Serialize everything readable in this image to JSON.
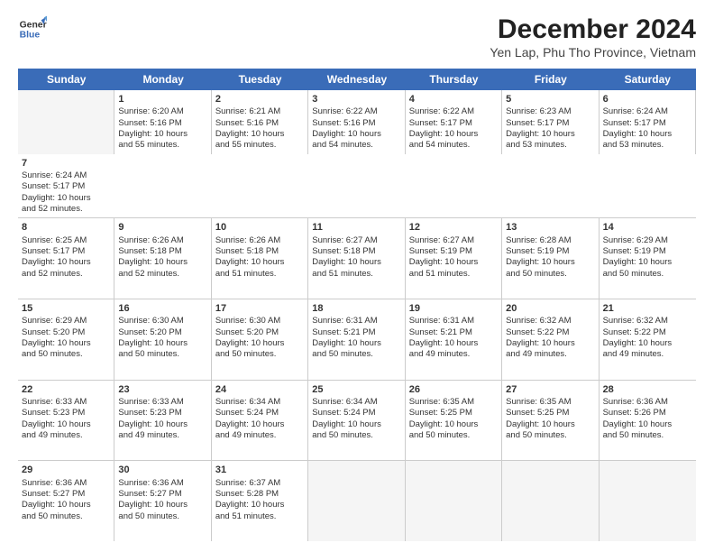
{
  "header": {
    "logo_line1": "General",
    "logo_line2": "Blue",
    "title": "December 2024",
    "subtitle": "Yen Lap, Phu Tho Province, Vietnam"
  },
  "days": [
    "Sunday",
    "Monday",
    "Tuesday",
    "Wednesday",
    "Thursday",
    "Friday",
    "Saturday"
  ],
  "rows": [
    [
      {
        "num": "",
        "lines": [],
        "empty": true
      },
      {
        "num": "1",
        "lines": [
          "Sunrise: 6:20 AM",
          "Sunset: 5:16 PM",
          "Daylight: 10 hours",
          "and 55 minutes."
        ],
        "empty": false
      },
      {
        "num": "2",
        "lines": [
          "Sunrise: 6:21 AM",
          "Sunset: 5:16 PM",
          "Daylight: 10 hours",
          "and 55 minutes."
        ],
        "empty": false
      },
      {
        "num": "3",
        "lines": [
          "Sunrise: 6:22 AM",
          "Sunset: 5:16 PM",
          "Daylight: 10 hours",
          "and 54 minutes."
        ],
        "empty": false
      },
      {
        "num": "4",
        "lines": [
          "Sunrise: 6:22 AM",
          "Sunset: 5:17 PM",
          "Daylight: 10 hours",
          "and 54 minutes."
        ],
        "empty": false
      },
      {
        "num": "5",
        "lines": [
          "Sunrise: 6:23 AM",
          "Sunset: 5:17 PM",
          "Daylight: 10 hours",
          "and 53 minutes."
        ],
        "empty": false
      },
      {
        "num": "6",
        "lines": [
          "Sunrise: 6:24 AM",
          "Sunset: 5:17 PM",
          "Daylight: 10 hours",
          "and 53 minutes."
        ],
        "empty": false
      },
      {
        "num": "7",
        "lines": [
          "Sunrise: 6:24 AM",
          "Sunset: 5:17 PM",
          "Daylight: 10 hours",
          "and 52 minutes."
        ],
        "empty": false
      }
    ],
    [
      {
        "num": "8",
        "lines": [
          "Sunrise: 6:25 AM",
          "Sunset: 5:17 PM",
          "Daylight: 10 hours",
          "and 52 minutes."
        ],
        "empty": false
      },
      {
        "num": "9",
        "lines": [
          "Sunrise: 6:26 AM",
          "Sunset: 5:18 PM",
          "Daylight: 10 hours",
          "and 52 minutes."
        ],
        "empty": false
      },
      {
        "num": "10",
        "lines": [
          "Sunrise: 6:26 AM",
          "Sunset: 5:18 PM",
          "Daylight: 10 hours",
          "and 51 minutes."
        ],
        "empty": false
      },
      {
        "num": "11",
        "lines": [
          "Sunrise: 6:27 AM",
          "Sunset: 5:18 PM",
          "Daylight: 10 hours",
          "and 51 minutes."
        ],
        "empty": false
      },
      {
        "num": "12",
        "lines": [
          "Sunrise: 6:27 AM",
          "Sunset: 5:19 PM",
          "Daylight: 10 hours",
          "and 51 minutes."
        ],
        "empty": false
      },
      {
        "num": "13",
        "lines": [
          "Sunrise: 6:28 AM",
          "Sunset: 5:19 PM",
          "Daylight: 10 hours",
          "and 50 minutes."
        ],
        "empty": false
      },
      {
        "num": "14",
        "lines": [
          "Sunrise: 6:29 AM",
          "Sunset: 5:19 PM",
          "Daylight: 10 hours",
          "and 50 minutes."
        ],
        "empty": false
      }
    ],
    [
      {
        "num": "15",
        "lines": [
          "Sunrise: 6:29 AM",
          "Sunset: 5:20 PM",
          "Daylight: 10 hours",
          "and 50 minutes."
        ],
        "empty": false
      },
      {
        "num": "16",
        "lines": [
          "Sunrise: 6:30 AM",
          "Sunset: 5:20 PM",
          "Daylight: 10 hours",
          "and 50 minutes."
        ],
        "empty": false
      },
      {
        "num": "17",
        "lines": [
          "Sunrise: 6:30 AM",
          "Sunset: 5:20 PM",
          "Daylight: 10 hours",
          "and 50 minutes."
        ],
        "empty": false
      },
      {
        "num": "18",
        "lines": [
          "Sunrise: 6:31 AM",
          "Sunset: 5:21 PM",
          "Daylight: 10 hours",
          "and 50 minutes."
        ],
        "empty": false
      },
      {
        "num": "19",
        "lines": [
          "Sunrise: 6:31 AM",
          "Sunset: 5:21 PM",
          "Daylight: 10 hours",
          "and 49 minutes."
        ],
        "empty": false
      },
      {
        "num": "20",
        "lines": [
          "Sunrise: 6:32 AM",
          "Sunset: 5:22 PM",
          "Daylight: 10 hours",
          "and 49 minutes."
        ],
        "empty": false
      },
      {
        "num": "21",
        "lines": [
          "Sunrise: 6:32 AM",
          "Sunset: 5:22 PM",
          "Daylight: 10 hours",
          "and 49 minutes."
        ],
        "empty": false
      }
    ],
    [
      {
        "num": "22",
        "lines": [
          "Sunrise: 6:33 AM",
          "Sunset: 5:23 PM",
          "Daylight: 10 hours",
          "and 49 minutes."
        ],
        "empty": false
      },
      {
        "num": "23",
        "lines": [
          "Sunrise: 6:33 AM",
          "Sunset: 5:23 PM",
          "Daylight: 10 hours",
          "and 49 minutes."
        ],
        "empty": false
      },
      {
        "num": "24",
        "lines": [
          "Sunrise: 6:34 AM",
          "Sunset: 5:24 PM",
          "Daylight: 10 hours",
          "and 49 minutes."
        ],
        "empty": false
      },
      {
        "num": "25",
        "lines": [
          "Sunrise: 6:34 AM",
          "Sunset: 5:24 PM",
          "Daylight: 10 hours",
          "and 50 minutes."
        ],
        "empty": false
      },
      {
        "num": "26",
        "lines": [
          "Sunrise: 6:35 AM",
          "Sunset: 5:25 PM",
          "Daylight: 10 hours",
          "and 50 minutes."
        ],
        "empty": false
      },
      {
        "num": "27",
        "lines": [
          "Sunrise: 6:35 AM",
          "Sunset: 5:25 PM",
          "Daylight: 10 hours",
          "and 50 minutes."
        ],
        "empty": false
      },
      {
        "num": "28",
        "lines": [
          "Sunrise: 6:36 AM",
          "Sunset: 5:26 PM",
          "Daylight: 10 hours",
          "and 50 minutes."
        ],
        "empty": false
      }
    ],
    [
      {
        "num": "29",
        "lines": [
          "Sunrise: 6:36 AM",
          "Sunset: 5:27 PM",
          "Daylight: 10 hours",
          "and 50 minutes."
        ],
        "empty": false
      },
      {
        "num": "30",
        "lines": [
          "Sunrise: 6:36 AM",
          "Sunset: 5:27 PM",
          "Daylight: 10 hours",
          "and 50 minutes."
        ],
        "empty": false
      },
      {
        "num": "31",
        "lines": [
          "Sunrise: 6:37 AM",
          "Sunset: 5:28 PM",
          "Daylight: 10 hours",
          "and 51 minutes."
        ],
        "empty": false
      },
      {
        "num": "",
        "lines": [],
        "empty": true
      },
      {
        "num": "",
        "lines": [],
        "empty": true
      },
      {
        "num": "",
        "lines": [],
        "empty": true
      },
      {
        "num": "",
        "lines": [],
        "empty": true
      }
    ]
  ]
}
